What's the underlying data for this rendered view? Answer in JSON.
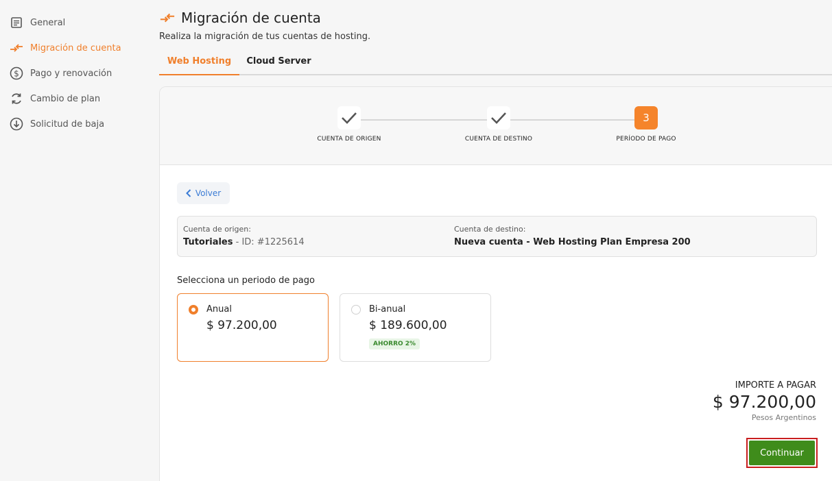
{
  "sidebar": {
    "items": [
      {
        "label": "General",
        "icon": "document-icon"
      },
      {
        "label": "Migración de cuenta",
        "icon": "migration-icon",
        "active": true
      },
      {
        "label": "Pago y renovación",
        "icon": "dollar-icon"
      },
      {
        "label": "Cambio de plan",
        "icon": "refresh-icon"
      },
      {
        "label": "Solicitud de baja",
        "icon": "download-circle-icon"
      }
    ]
  },
  "header": {
    "title": "Migración de cuenta",
    "subtitle": "Realiza la migración de tus cuentas de hosting."
  },
  "tabs": [
    {
      "label": "Web Hosting",
      "active": true
    },
    {
      "label": "Cloud Server",
      "active": false
    }
  ],
  "stepper": {
    "steps": [
      {
        "label": "CUENTA DE ORIGEN",
        "state": "done"
      },
      {
        "label": "CUENTA DE DESTINO",
        "state": "done"
      },
      {
        "label": "PERÍODO DE PAGO",
        "state": "current",
        "number": "3"
      }
    ]
  },
  "back_label": "Volver",
  "accounts": {
    "origin_label": "Cuenta de origen:",
    "origin_name": "Tutoriales",
    "origin_id": " - ID: #1225614",
    "destination_label": "Cuenta de destino:",
    "destination_value": "Nueva cuenta - Web Hosting Plan Empresa 200"
  },
  "period": {
    "title": "Selecciona un periodo de pago",
    "options": [
      {
        "name": "Anual",
        "price": "$ 97.200,00",
        "selected": true
      },
      {
        "name": "Bi-anual",
        "price": "$ 189.600,00",
        "badge": "AHORRO 2%",
        "selected": false
      }
    ]
  },
  "total": {
    "label": "IMPORTE A PAGAR",
    "amount": "$ 97.200,00",
    "currency": "Pesos Argentinos"
  },
  "continue_label": "Continuar",
  "colors": {
    "accent": "#f07f2b",
    "success": "#3f8c1b",
    "link": "#3a7bd5",
    "highlight_border": "#c81e1e"
  }
}
